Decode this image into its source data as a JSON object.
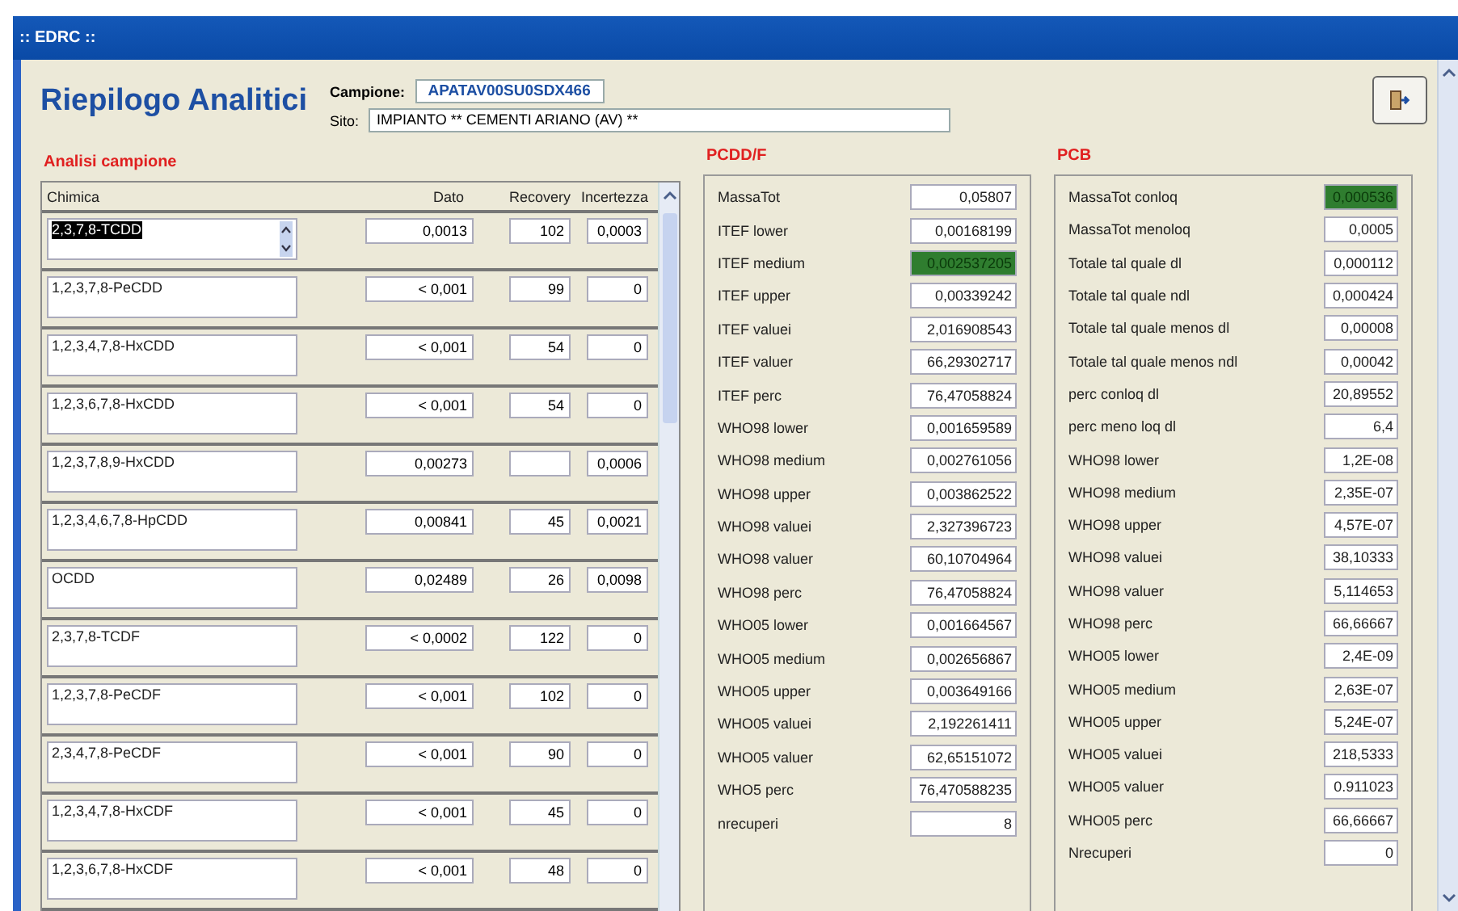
{
  "window": {
    "title": ":: EDRC ::"
  },
  "header": {
    "title": "Riepilogo Analitici",
    "campione_label": "Campione:",
    "campione_value": "APATAV00SU0SDX466",
    "sito_label": "Sito:",
    "sito_value": "IMPIANTO ** CEMENTI ARIANO (AV) **"
  },
  "analisi": {
    "title": "Analisi campione",
    "columns": [
      "Chimica",
      "Dato",
      "Recovery",
      "Incertezza"
    ],
    "rows": [
      {
        "chimica": "2,3,7,8-TCDD",
        "dato": "0,0013",
        "recovery": "102",
        "incertezza": "0,0003",
        "selected": true
      },
      {
        "chimica": "1,2,3,7,8-PeCDD",
        "dato": "< 0,001",
        "recovery": "99",
        "incertezza": "0",
        "selected": false
      },
      {
        "chimica": "1,2,3,4,7,8-HxCDD",
        "dato": "< 0,001",
        "recovery": "54",
        "incertezza": "0",
        "selected": false
      },
      {
        "chimica": "1,2,3,6,7,8-HxCDD",
        "dato": "< 0,001",
        "recovery": "54",
        "incertezza": "0",
        "selected": false
      },
      {
        "chimica": "1,2,3,7,8,9-HxCDD",
        "dato": "0,00273",
        "incertezza": "0,0006",
        "selected": false
      },
      {
        "chimica": "1,2,3,4,6,7,8-HpCDD",
        "dato": "0,00841",
        "recovery": "45",
        "incertezza": "0,0021",
        "selected": false
      },
      {
        "chimica": "OCDD",
        "dato": "0,02489",
        "recovery": "26",
        "incertezza": "0,0098",
        "selected": false
      },
      {
        "chimica": "2,3,7,8-TCDF",
        "dato": "< 0,0002",
        "recovery": "122",
        "incertezza": "0",
        "selected": false
      },
      {
        "chimica": "1,2,3,7,8-PeCDF",
        "dato": "< 0,001",
        "recovery": "102",
        "incertezza": "0",
        "selected": false
      },
      {
        "chimica": "2,3,4,7,8-PeCDF",
        "dato": "< 0,001",
        "recovery": "90",
        "incertezza": "0",
        "selected": false
      },
      {
        "chimica": "1,2,3,4,7,8-HxCDF",
        "dato": "< 0,001",
        "recovery": "45",
        "incertezza": "0",
        "selected": false
      },
      {
        "chimica": "1,2,3,6,7,8-HxCDF",
        "dato": "< 0,001",
        "recovery": "48",
        "incertezza": "0",
        "selected": false
      }
    ]
  },
  "pcdd": {
    "title": "PCDD/F",
    "rows": [
      {
        "label": "MassaTot",
        "value": "0,05807",
        "highlighted": false
      },
      {
        "label": "ITEF lower",
        "value": "0,00168199",
        "highlighted": false
      },
      {
        "label": "ITEF medium",
        "value": "0,002537205",
        "highlighted": true
      },
      {
        "label": "ITEF upper",
        "value": "0,00339242",
        "highlighted": false
      },
      {
        "label": "ITEF valuei",
        "value": "2,016908543",
        "highlighted": false
      },
      {
        "label": "ITEF valuer",
        "value": "66,29302717",
        "highlighted": false
      },
      {
        "label": "ITEF perc",
        "value": "76,47058824",
        "highlighted": false
      },
      {
        "label": "WHO98 lower",
        "value": "0,001659589",
        "highlighted": false
      },
      {
        "label": "WHO98 medium",
        "value": "0,002761056",
        "highlighted": false
      },
      {
        "label": "WHO98 upper",
        "value": "0,003862522",
        "highlighted": false
      },
      {
        "label": "WHO98 valuei",
        "value": "2,327396723",
        "highlighted": false
      },
      {
        "label": "WHO98 valuer",
        "value": "60,10704964",
        "highlighted": false
      },
      {
        "label": "WHO98 perc",
        "value": "76,47058824",
        "highlighted": false
      },
      {
        "label": "WHO05 lower",
        "value": "0,001664567",
        "highlighted": false
      },
      {
        "label": "WHO05 medium",
        "value": "0,002656867",
        "highlighted": false
      },
      {
        "label": "WHO05 upper",
        "value": "0,003649166",
        "highlighted": false
      },
      {
        "label": "WHO05 valuei",
        "value": "2,192261411",
        "highlighted": false
      },
      {
        "label": "WHO05 valuer",
        "value": "62,65151072",
        "highlighted": false
      },
      {
        "label": "WHO5 perc",
        "value": "76,470588235",
        "highlighted": false
      },
      {
        "label": "nrecuperi",
        "value": "8",
        "highlighted": false
      }
    ]
  },
  "pcb": {
    "title": "PCB",
    "rows": [
      {
        "label": "MassaTot conloq",
        "value": "0,000536",
        "highlighted": true
      },
      {
        "label": "MassaTot menoloq",
        "value": "0,0005",
        "highlighted": false
      },
      {
        "label": "Totale tal quale dl",
        "value": "0,000112",
        "highlighted": false
      },
      {
        "label": "Totale tal quale ndl",
        "value": "0,000424",
        "highlighted": false
      },
      {
        "label": "Totale tal quale menos dl",
        "value": "0,00008",
        "highlighted": false
      },
      {
        "label": "Totale tal quale menos ndl",
        "value": "0,00042",
        "highlighted": false
      },
      {
        "label": "perc conloq dl",
        "value": "20,89552",
        "highlighted": false
      },
      {
        "label": "perc meno loq dl",
        "value": "6,4",
        "highlighted": false
      },
      {
        "label": "WHO98 lower",
        "value": "1,2E-08",
        "highlighted": false
      },
      {
        "label": "WHO98 medium",
        "value": "2,35E-07",
        "highlighted": false
      },
      {
        "label": "WHO98 upper",
        "value": "4,57E-07",
        "highlighted": false
      },
      {
        "label": "WHO98 valuei",
        "value": "38,10333",
        "highlighted": false
      },
      {
        "label": "WHO98 valuer",
        "value": "5,114653",
        "highlighted": false
      },
      {
        "label": "WHO98 perc",
        "value": "66,66667",
        "highlighted": false
      },
      {
        "label": "WHO05 lower",
        "value": "2,4E-09",
        "highlighted": false
      },
      {
        "label": "WHO05 medium",
        "value": "2,63E-07",
        "highlighted": false
      },
      {
        "label": "WHO05 upper",
        "value": "5,24E-07",
        "highlighted": false
      },
      {
        "label": "WHO05 valuei",
        "value": "218,5333",
        "highlighted": false
      },
      {
        "label": "WHO05 valuer",
        "value": "0.911023",
        "highlighted": false
      },
      {
        "label": "WHO05 perc",
        "value": "66,66667",
        "highlighted": false
      },
      {
        "label": "Nrecuperi",
        "value": "0",
        "highlighted": false
      }
    ]
  }
}
